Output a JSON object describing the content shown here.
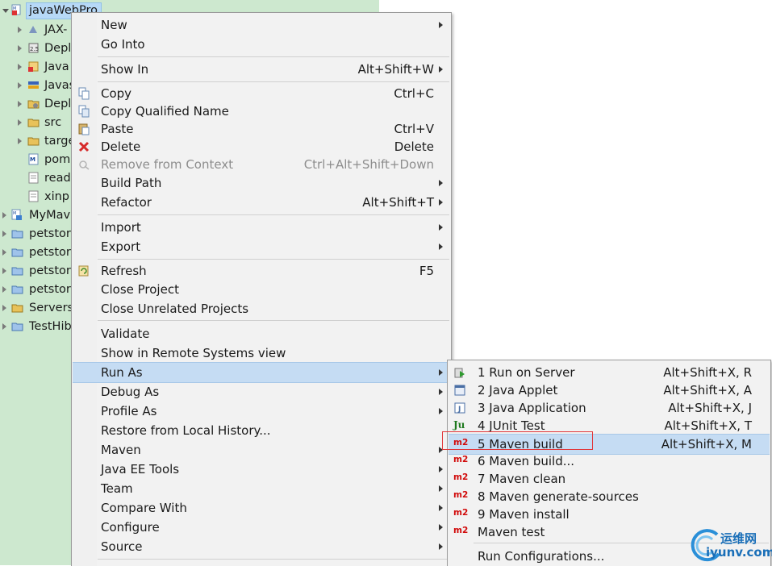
{
  "tree": {
    "root": "javaWebPro",
    "children": [
      "JAX-",
      "Depl",
      "Java",
      "Javas",
      "Depl",
      "src",
      "targe",
      "pom",
      "read",
      "xinp"
    ],
    "projects": [
      "MyMav",
      "petstor",
      "petstor",
      "petstor",
      "petstor",
      "Servers",
      "TestHib"
    ]
  },
  "context_menu": {
    "items": [
      {
        "label": "New",
        "shortcut": ""
      },
      {
        "label": "Go Into",
        "shortcut": ""
      },
      {
        "label": "Show In",
        "shortcut": "Alt+Shift+W"
      },
      {
        "label": "Copy",
        "shortcut": "Ctrl+C"
      },
      {
        "label": "Copy Qualified Name",
        "shortcut": ""
      },
      {
        "label": "Paste",
        "shortcut": "Ctrl+V"
      },
      {
        "label": "Delete",
        "shortcut": "Delete"
      },
      {
        "label": "Remove from Context",
        "shortcut": "Ctrl+Alt+Shift+Down"
      },
      {
        "label": "Build Path",
        "shortcut": ""
      },
      {
        "label": "Refactor",
        "shortcut": "Alt+Shift+T"
      },
      {
        "label": "Import",
        "shortcut": ""
      },
      {
        "label": "Export",
        "shortcut": ""
      },
      {
        "label": "Refresh",
        "shortcut": "F5"
      },
      {
        "label": "Close Project",
        "shortcut": ""
      },
      {
        "label": "Close Unrelated Projects",
        "shortcut": ""
      },
      {
        "label": "Validate",
        "shortcut": ""
      },
      {
        "label": "Show in Remote Systems view",
        "shortcut": ""
      },
      {
        "label": "Run As",
        "shortcut": ""
      },
      {
        "label": "Debug As",
        "shortcut": ""
      },
      {
        "label": "Profile As",
        "shortcut": ""
      },
      {
        "label": "Restore from Local History...",
        "shortcut": ""
      },
      {
        "label": "Maven",
        "shortcut": ""
      },
      {
        "label": "Java EE Tools",
        "shortcut": ""
      },
      {
        "label": "Team",
        "shortcut": ""
      },
      {
        "label": "Compare With",
        "shortcut": ""
      },
      {
        "label": "Configure",
        "shortcut": ""
      },
      {
        "label": "Source",
        "shortcut": ""
      }
    ]
  },
  "run_as_menu": {
    "items": [
      {
        "label": "1 Run on Server",
        "shortcut": "Alt+Shift+X, R",
        "icon": "server-run-icon"
      },
      {
        "label": "2 Java Applet",
        "shortcut": "Alt+Shift+X, A",
        "icon": "applet-icon"
      },
      {
        "label": "3 Java Application",
        "shortcut": "Alt+Shift+X, J",
        "icon": "java-app-icon"
      },
      {
        "label": "4 JUnit Test",
        "shortcut": "Alt+Shift+X, T",
        "icon": "junit-icon"
      },
      {
        "label": "5 Maven build",
        "shortcut": "Alt+Shift+X, M",
        "icon": "m2"
      },
      {
        "label": "6 Maven build...",
        "shortcut": "",
        "icon": "m2"
      },
      {
        "label": "7 Maven clean",
        "shortcut": "",
        "icon": "m2"
      },
      {
        "label": "8 Maven generate-sources",
        "shortcut": "",
        "icon": "m2"
      },
      {
        "label": "9 Maven install",
        "shortcut": "",
        "icon": "m2"
      },
      {
        "label": "Maven test",
        "shortcut": "",
        "icon": "m2"
      },
      {
        "label": "Run Configurations...",
        "shortcut": "",
        "icon": ""
      }
    ],
    "icon_text": "m2",
    "junit_icon_text": "Ju"
  },
  "watermark": {
    "line1": "运维网",
    "line2": "iyunv.com"
  },
  "colors": {
    "tree_bg": "#cde8cf",
    "menu_bg": "#f2f2f2",
    "highlight": "#c5dcf3",
    "maven_red": "#d10b0b",
    "callout_red": "#e0383b"
  }
}
